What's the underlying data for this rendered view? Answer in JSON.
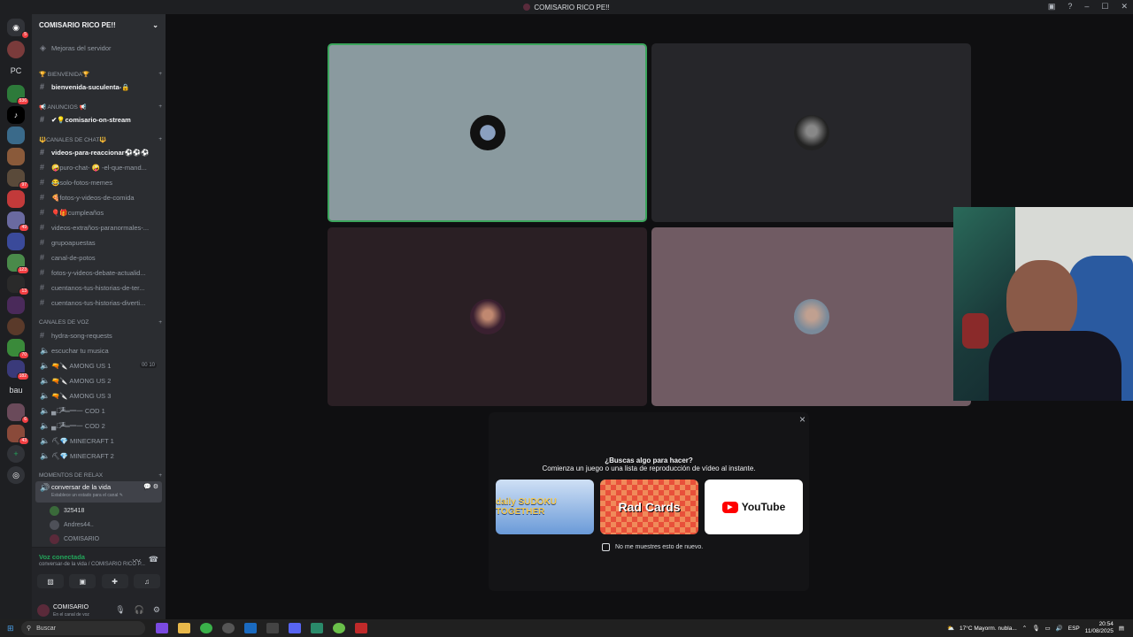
{
  "window": {
    "title": "COMISARIO RICO PE!!"
  },
  "servers": {
    "badges": [
      "5",
      "536",
      "97",
      "49",
      "123",
      "13",
      "70",
      "182",
      "6",
      "43"
    ],
    "labels": {
      "pc": "PC",
      "bau": "bau"
    }
  },
  "guild": {
    "name": "COMISARIO RICO PE!!",
    "boost": "Mejoras del servidor",
    "categories": {
      "bienvenida": "🏆 BIENVENIDA🏆",
      "anuncios": "📢 ANUNCIOS 📢",
      "chat": "🔱CANALES DE CHAT🔱",
      "voz": "CANALES DE VOZ",
      "relax": "MOMENTOS DE RELAX"
    },
    "channels": {
      "bienvenida": "bienvenida-suculenta-🔒",
      "stream": "✔💡comisario-on-stream",
      "reaccionar": "videos-para-reaccionar⚽⚽⚽",
      "purochat": "🤪puro-chat- 🤪 -el-que-mand...",
      "memes": "😂solo-fotos-memes",
      "comida": "🍕fotos-y-videos-de-comida",
      "cumple": "🎈🎁cumpleaños",
      "paranormales": "videos-extraños-paranormales-...",
      "apuestas": "grupoapuestas",
      "potos": "canal-de-potos",
      "debate": "fotos-y-videos-debate-actualid...",
      "historias1": "cuentanos-tus-historias-de-ter...",
      "historias2": "cuentanos-tus-historias-diverti..."
    },
    "voice": {
      "hydra": "hydra-song-requests",
      "musica": "escuchar tu musica",
      "among1": "🔫🔪 AMONG US 1",
      "among1_count_a": "00",
      "among1_count_b": "10",
      "among2": "🔫🔪 AMONG US 2",
      "among3": "🔫🔪 AMONG US 3",
      "cod1": "▄︻̷̿┻̿═━一 COD 1",
      "cod2": "▄︻̷̿┻̿═━一 COD 2",
      "mine1": "⛏💎 MINECRAFT 1",
      "mine2": "⛏💎 MINECRAFT 2",
      "relax": "conversar de la vida",
      "relax_status": "Establece un estado para el canal ✎",
      "users": [
        "325418",
        "Andres44..",
        "COMISARIO"
      ]
    }
  },
  "voice_panel": {
    "status": "Voz conectada",
    "channel": "conversar-de la vida / COMISARIO RICO P..."
  },
  "user_panel": {
    "name": "COMISARIO",
    "status": "En el canal de voz"
  },
  "activity_popup": {
    "question": "¿Buscas algo para hacer?",
    "subtitle": "Comienza un juego o una lista de reproducción de vídeo al instante.",
    "cards": [
      "daily SUDOKU TOGETHER",
      "Rad Cards",
      "YouTube"
    ],
    "checkbox_label": "No me muestres esto de nuevo."
  },
  "taskbar": {
    "search": "Buscar",
    "weather": "17°C  Mayorm. nubla...",
    "lang": "ESP",
    "time": "20:54",
    "date": "11/08/2025"
  },
  "colors": {
    "accent_green": "#23a55a",
    "tile_teal": "#8a9a9f",
    "tile_dark": "#26262a",
    "tile_maroon": "#2a1f24",
    "tile_mauve": "#705b63"
  }
}
